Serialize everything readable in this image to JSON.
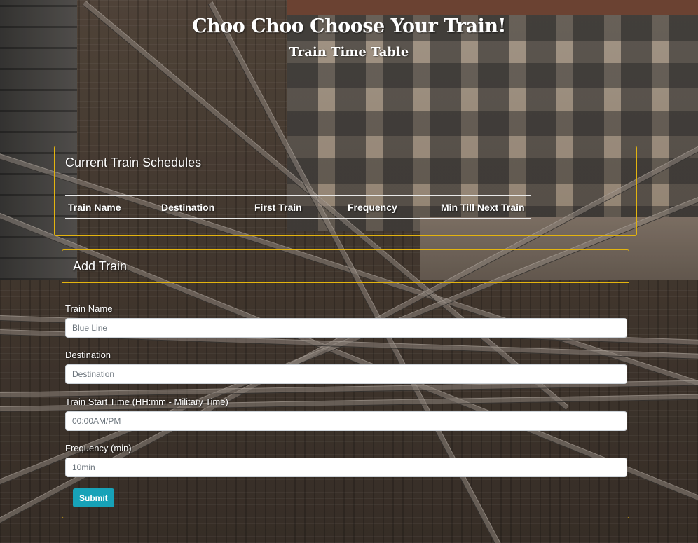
{
  "header": {
    "title": "Choo Choo Choose Your Train!",
    "subtitle": "Train Time Table"
  },
  "schedule": {
    "title": "Current Train Schedules",
    "columns": [
      "Train Name",
      "Destination",
      "First Train",
      "Frequency",
      "Min Till Next Train"
    ]
  },
  "add_train": {
    "title": "Add Train",
    "fields": [
      {
        "label": "Train Name",
        "placeholder": "Blue Line",
        "value": ""
      },
      {
        "label": "Destination",
        "placeholder": "Destination",
        "value": ""
      },
      {
        "label": "Train Start Time (HH:mm - Military Time)",
        "placeholder": "00:00AM/PM",
        "value": ""
      },
      {
        "label": "Frequency (min)",
        "placeholder": "10min",
        "value": ""
      }
    ],
    "submit_label": "Submit"
  },
  "colors": {
    "card_border": "#e3b40f",
    "submit_button": "#17a2b8"
  }
}
